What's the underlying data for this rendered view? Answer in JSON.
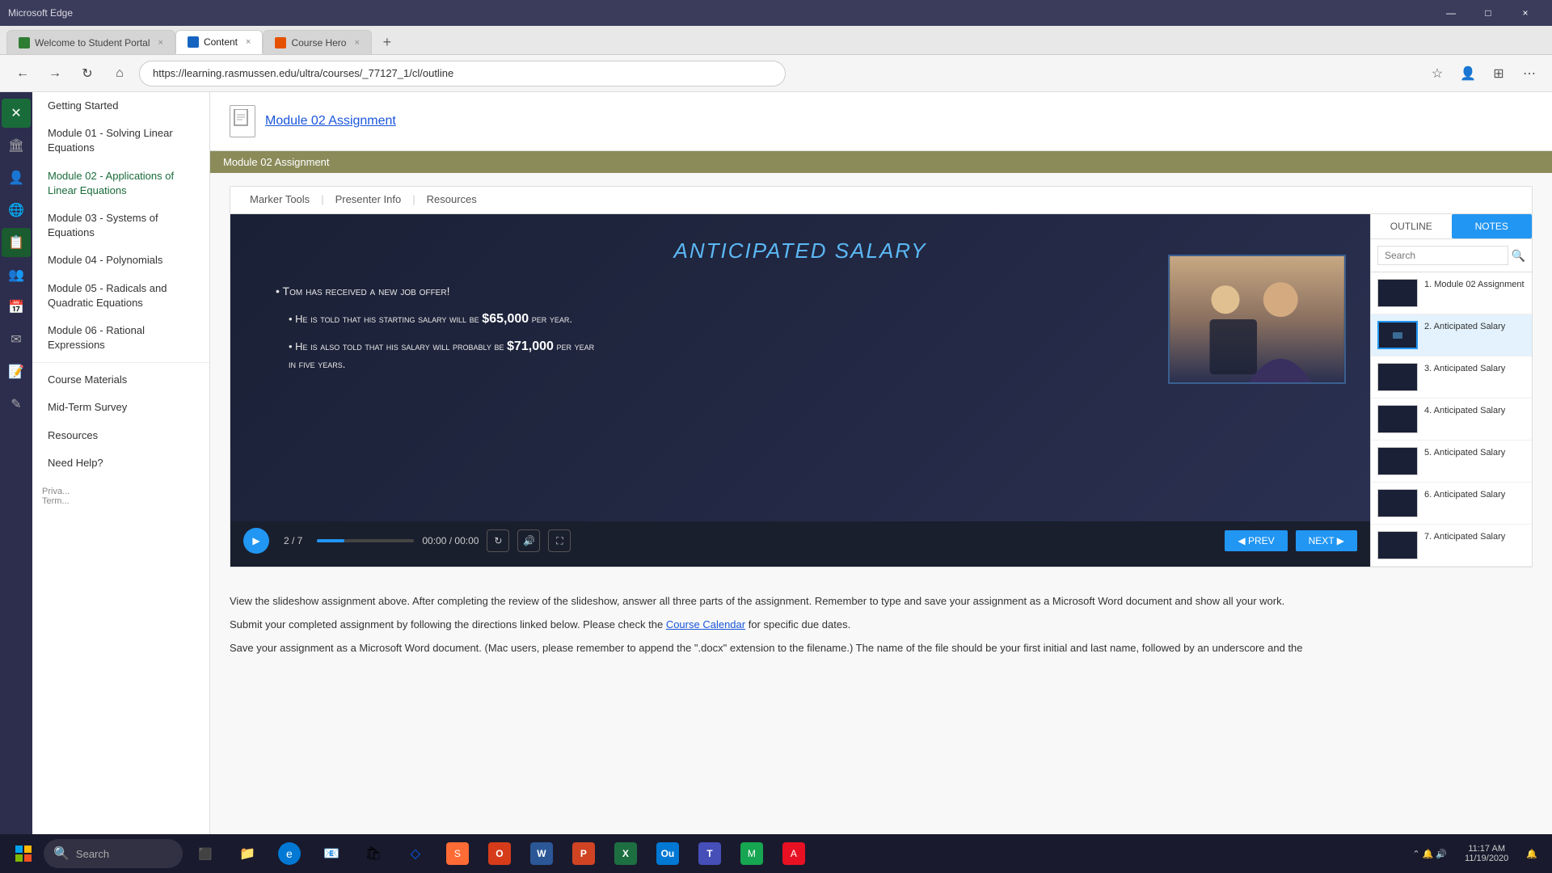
{
  "browser": {
    "title_bar": "Microsoft Edge",
    "tabs": [
      {
        "id": "tab1",
        "label": "Welcome to Student Portal",
        "favicon": "green",
        "active": false,
        "close": "×"
      },
      {
        "id": "tab2",
        "label": "Content",
        "favicon": "blue",
        "active": true,
        "close": "×"
      },
      {
        "id": "tab3",
        "label": "Course Hero",
        "favicon": "orange",
        "active": false,
        "close": "×"
      }
    ],
    "address": "https://learning.rasmussen.edu/ultra/courses/_77127_1/cl/outline",
    "new_tab_icon": "+",
    "back_icon": "←",
    "forward_icon": "→",
    "refresh_icon": "↻",
    "home_icon": "⌂",
    "win_min": "—",
    "win_max": "□",
    "win_close": "×"
  },
  "icon_sidebar": {
    "items": [
      {
        "icon": "✕",
        "name": "close-icon",
        "active": true
      },
      {
        "icon": "🏛",
        "name": "institution-icon",
        "active": false
      },
      {
        "icon": "👤",
        "name": "profile-icon",
        "active": false
      },
      {
        "icon": "🌐",
        "name": "globe-icon",
        "active": false
      },
      {
        "icon": "📋",
        "name": "content-icon",
        "active": false
      },
      {
        "icon": "👥",
        "name": "groups-icon",
        "active": false
      },
      {
        "icon": "📅",
        "name": "calendar-icon",
        "active": false
      },
      {
        "icon": "✉",
        "name": "messages-icon",
        "active": false
      },
      {
        "icon": "📝",
        "name": "notes-icon",
        "active": false
      },
      {
        "icon": "✎",
        "name": "edit-icon",
        "active": false
      },
      {
        "icon": "↩",
        "name": "back-icon",
        "active": false
      }
    ]
  },
  "course_sidebar": {
    "header": "Getting Started",
    "items": [
      {
        "label": "Getting Started",
        "active": false
      },
      {
        "label": "Module 01 - Solving Linear Equations",
        "active": false
      },
      {
        "label": "Module 02 - Applications of Linear Equations",
        "active": true
      },
      {
        "label": "Module 03 - Systems of Equations",
        "active": false
      },
      {
        "label": "Module 04 - Polynomials",
        "active": false
      },
      {
        "label": "Module 05 - Radicals and Quadratic Equations",
        "active": false
      },
      {
        "label": "Module 06 - Rational Expressions",
        "active": false
      },
      {
        "label": "Course Materials",
        "active": false
      },
      {
        "label": "Mid-Term Survey",
        "active": false
      },
      {
        "label": "Resources",
        "active": false
      },
      {
        "label": "Need Help?",
        "active": false
      }
    ]
  },
  "content": {
    "module_title": "Module 02 Assignment",
    "assignment_banner": "Module 02 Assignment",
    "slide": {
      "tabs": [
        {
          "label": "Marker Tools",
          "active": false
        },
        {
          "label": "Presenter Info",
          "active": false
        },
        {
          "label": "Resources",
          "active": false
        }
      ],
      "title": "Anticipated Salary",
      "bullets": [
        {
          "text": "Tom has received a new job offer!",
          "sub_bullets": [
            "He is told that his starting salary will be $65,000 per year.",
            "He is also told that his salary will probably be $71,000 per year in five years."
          ]
        }
      ],
      "controls": {
        "play_icon": "▶",
        "counter": "2 / 7",
        "time": "00:00 / 00:00",
        "refresh_icon": "↻",
        "volume_icon": "🔊",
        "fullscreen_icon": "⛶",
        "prev_label": "◀ PREV",
        "next_label": "NEXT ▶"
      }
    },
    "outline_panel": {
      "tabs": [
        {
          "label": "OUTLINE",
          "active": false
        },
        {
          "label": "NOTES",
          "active": true
        }
      ],
      "search_placeholder": "Search",
      "items": [
        {
          "number": "1.",
          "label": "Module 02 Assignment",
          "active": false
        },
        {
          "number": "2.",
          "label": "Anticipated Salary",
          "active": true
        },
        {
          "number": "3.",
          "label": "Anticipated Salary",
          "active": false
        },
        {
          "number": "4.",
          "label": "Anticipated Salary",
          "active": false
        },
        {
          "number": "5.",
          "label": "Anticipated Salary",
          "active": false
        },
        {
          "number": "6.",
          "label": "Anticipated Salary",
          "active": false
        },
        {
          "number": "7.",
          "label": "Anticipated Salary",
          "active": false
        }
      ]
    },
    "description": {
      "line1": "View the slideshow assignment above. After completing the review of the slideshow, answer all three parts of the assignment. Remember to type and save your assignment as a Microsoft Word document and show all your work.",
      "line2": "Submit your completed assignment by following the directions linked below. Please check the",
      "link_text": "Course Calendar",
      "line2_end": "for specific due dates.",
      "line3": "Save your assignment as a Microsoft Word document. (Mac users, please remember to append the \".docx\" extension to the filename.) The name of the file should be your first initial and last name, followed by an underscore and the"
    }
  },
  "taskbar": {
    "search_placeholder": "Search",
    "search_icon": "🔍",
    "time": "11:17 AM",
    "date": "11/19/2020",
    "icons": [
      {
        "icon": "⬛",
        "name": "task-view"
      },
      {
        "icon": "📁",
        "name": "file-explorer"
      },
      {
        "icon": "🌐",
        "name": "edge"
      },
      {
        "icon": "📧",
        "name": "mail"
      },
      {
        "icon": "📦",
        "name": "store"
      },
      {
        "icon": "🟨",
        "name": "app1"
      },
      {
        "icon": "🔵",
        "name": "app2"
      },
      {
        "icon": "🟥",
        "name": "app3"
      },
      {
        "icon": "📊",
        "name": "excel"
      },
      {
        "icon": "📮",
        "name": "outlook"
      },
      {
        "icon": "💬",
        "name": "teams"
      },
      {
        "icon": "📎",
        "name": "app4"
      },
      {
        "icon": "🖼",
        "name": "app5"
      }
    ]
  }
}
